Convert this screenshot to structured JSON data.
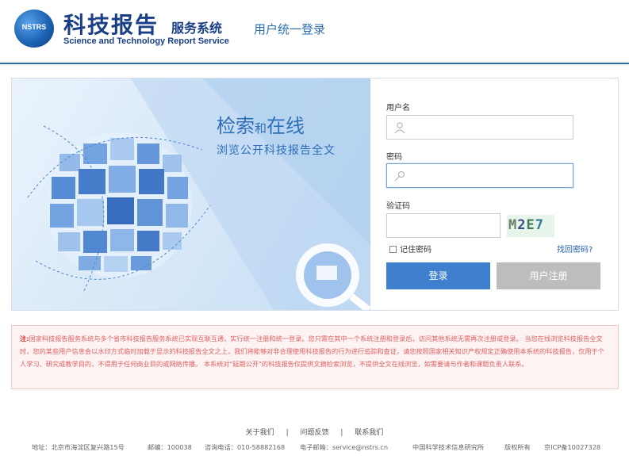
{
  "header": {
    "logo_badge": "NSTRS",
    "title_main": "科技报告",
    "title_small": "服务系统",
    "subtitle": "Science and Technology Report Service",
    "login_label": "用户统一登录"
  },
  "banner": {
    "title_part1": "检索",
    "title_part2": "和",
    "title_part3": "在线",
    "subtitle": "浏览公开科技报告全文"
  },
  "form": {
    "username_label": "用户名",
    "username_value": "",
    "password_label": "密码",
    "password_value": "",
    "captcha_label": "验证码",
    "captcha_value": "",
    "captcha_chars": [
      "M",
      "2",
      "E",
      "7"
    ],
    "remember_label": "记住密码",
    "remember_checked": false,
    "forgot_label": "找回密码?",
    "login_button": "登录",
    "register_button": "用户注册"
  },
  "notice": {
    "prefix": "注:",
    "text": "国家科技报告服务系统与多个省市科技报告服务系统已实现互联互通，实行统一注册和统一登录。您只需在其中一个系统注册和登录后，访问其他系统无需再次注册或登录。 当您在线浏览科技报告全文时，您的某些用户信息会以水印方式临时加载于显示的科技报告全文之上，我们将能够对非合理使用科技报告的行为进行追踪和查证，请您按照国家相关知识产权规定正确使用本系统的科技报告，仅用于个人学习、研究或教学目的，不得用于任何商业目的或网络传播。 本系统对\"延期公开\"的科技报告仅提供文摘检索浏览，不提供全文在线浏览，如需要请与作者和课题负责人联系。"
  },
  "footer": {
    "links": [
      "关于我们",
      "问题反馈",
      "联系我们"
    ],
    "separator": "|",
    "address": "地址：北京市海淀区复兴路15号",
    "postcode": "邮编：100038",
    "phone": "咨询电话：010-58882168",
    "email": "电子邮箱：service@nstrs.cn",
    "institute": "中国科学技术信息研究所",
    "copyright": "版权所有",
    "icp": "京ICP备10027328"
  },
  "colors": {
    "brand_blue": "#1a3f86",
    "accent_blue": "#3f7fcd",
    "register_gray": "#bdbdbd",
    "notice_red": "#e06060"
  }
}
